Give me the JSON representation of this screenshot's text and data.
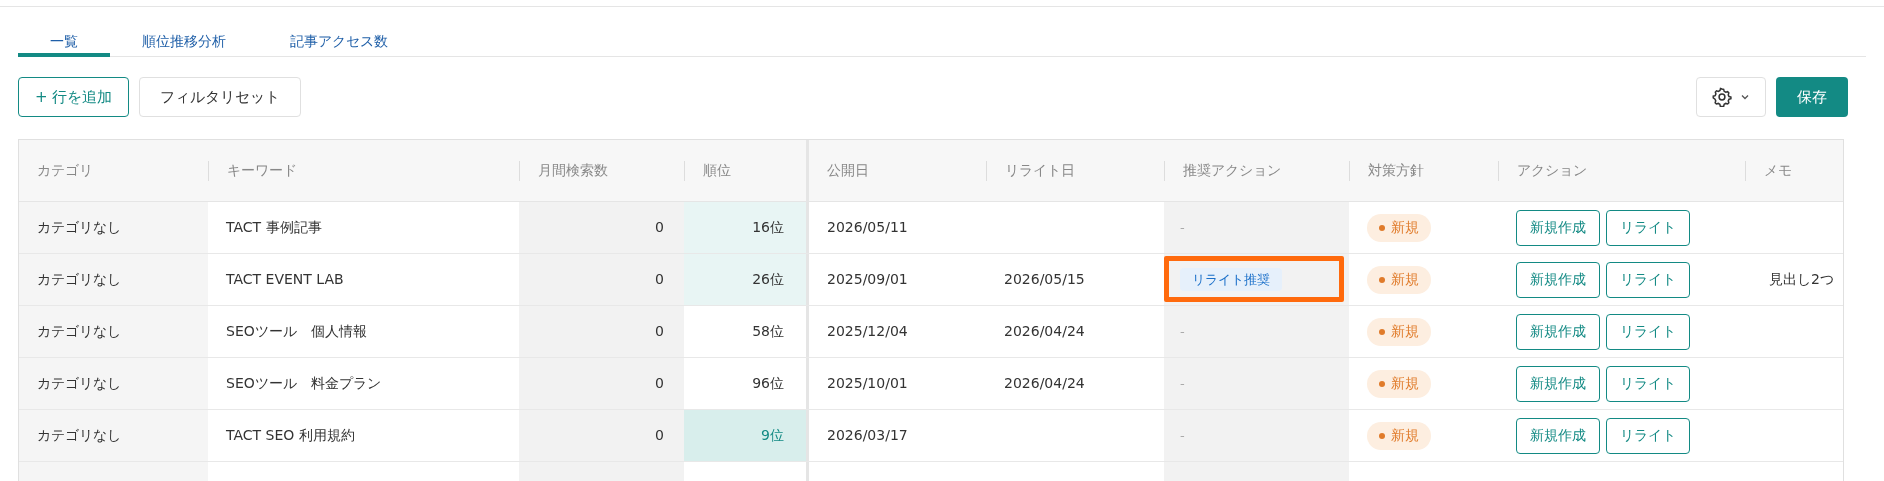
{
  "tabs": [
    {
      "label": "一覧",
      "selected": true
    },
    {
      "label": "順位推移分析",
      "selected": false
    },
    {
      "label": "記事アクセス数",
      "selected": false
    }
  ],
  "toolbar": {
    "add_row": "+ 行を追加",
    "filter_reset": "フィルタリセット",
    "save": "保存"
  },
  "table": {
    "columns": [
      "カテゴリ",
      "キーワード",
      "月間検索数",
      "順位",
      "公開日",
      "リライト日",
      "推奨アクション",
      "対策方針",
      "アクション",
      "メモ"
    ],
    "rows": [
      {
        "category": "カテゴリなし",
        "keyword": "TACT 事例記事",
        "monthly_searches": "0",
        "rank": {
          "text": "16位",
          "highlighted": true,
          "top": false
        },
        "published": "2026/05/11",
        "recommended": {
          "kind": "empty",
          "text": "-",
          "annotated": false
        },
        "policy": "新規",
        "actions": [
          "新規作成",
          "リライト"
        ]
      },
      {
        "category": "カテゴリなし",
        "keyword": "TACT EVENT LAB",
        "monthly_searches": "0",
        "rank": {
          "text": "26位",
          "highlighted": true,
          "top": false
        },
        "published": "2025/09/01",
        "rewritten": "2026/05/15",
        "recommended": {
          "kind": "tag",
          "text": "リライト推奨",
          "annotated": true
        },
        "policy": "新規",
        "actions": [
          "新規作成",
          "リライト"
        ],
        "memo": "見出し2つ"
      },
      {
        "category": "カテゴリなし",
        "keyword": "SEOツール　個人情報",
        "monthly_searches": "0",
        "rank": {
          "text": "58位",
          "highlighted": false,
          "top": false
        },
        "published": "2025/12/04",
        "rewritten": "2026/04/24",
        "recommended": {
          "kind": "empty",
          "text": "-",
          "annotated": false
        },
        "policy": "新規",
        "actions": [
          "新規作成",
          "リライト"
        ]
      },
      {
        "category": "カテゴリなし",
        "keyword": "SEOツール　料金プラン",
        "monthly_searches": "0",
        "rank": {
          "text": "96位",
          "highlighted": false,
          "top": false
        },
        "published": "2025/10/01",
        "rewritten": "2026/04/24",
        "recommended": {
          "kind": "empty",
          "text": "-",
          "annotated": false
        },
        "policy": "新規",
        "actions": [
          "新規作成",
          "リライト"
        ]
      },
      {
        "category": "カテゴリなし",
        "keyword": "TACT SEO 利用規約",
        "monthly_searches": "0",
        "rank": {
          "text": "9位",
          "highlighted": true,
          "top": true
        },
        "published": "2026/03/17",
        "recommended": {
          "kind": "empty",
          "text": "-",
          "annotated": false
        },
        "policy": "新規",
        "actions": [
          "新規作成",
          "リライト"
        ]
      }
    ]
  }
}
